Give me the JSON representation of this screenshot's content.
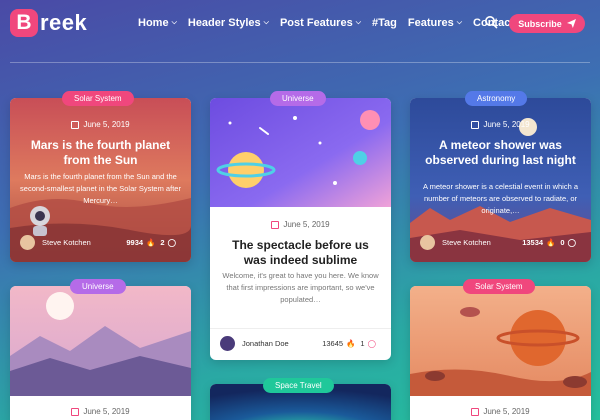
{
  "logo": {
    "letter": "B",
    "text": "reek"
  },
  "nav": [
    {
      "label": "Home",
      "dropdown": true
    },
    {
      "label": "Header Styles",
      "dropdown": true
    },
    {
      "label": "Post Features",
      "dropdown": true
    },
    {
      "label": "#Tag",
      "dropdown": false
    },
    {
      "label": "Features",
      "dropdown": true
    },
    {
      "label": "Contact",
      "dropdown": false
    }
  ],
  "subscribe_label": "Subscribe",
  "colors": {
    "accent": "#f0477d",
    "tag_pink": "#f0477d",
    "tag_purple": "#b56be8",
    "tag_blue": "#5479e8",
    "tag_green": "#1fc89a"
  },
  "posts": [
    {
      "tag": "Solar System",
      "date": "June 5, 2019",
      "title": "Mars is the fourth planet from the Sun",
      "excerpt": "Mars is the fourth planet from the Sun and the second-smallest planet in the Solar System after Mercury…",
      "author": "Steve Kotchen",
      "views": "9934",
      "comments": "2"
    },
    {
      "tag": "Universe",
      "date": "June 5, 2019",
      "title": "The spectacle before us was indeed sublime",
      "excerpt": "Welcome, it's great to have you here. We know that first impressions are important, so we've populated…",
      "author": "Jonathan Doe",
      "views": "13645",
      "comments": "1"
    },
    {
      "tag": "Astronomy",
      "date": "June 5, 2019",
      "title": "A meteor shower was observed during last night",
      "excerpt": "A meteor shower is a celestial event in which a number of meteors are observed to radiate, or originate,…",
      "author": "Steve Kotchen",
      "views": "13534",
      "comments": "0"
    },
    {
      "tag": "Universe",
      "date": "June 5, 2019"
    },
    {
      "tag": "Space Travel"
    },
    {
      "tag": "Solar System",
      "date": "June 5, 2019"
    }
  ]
}
